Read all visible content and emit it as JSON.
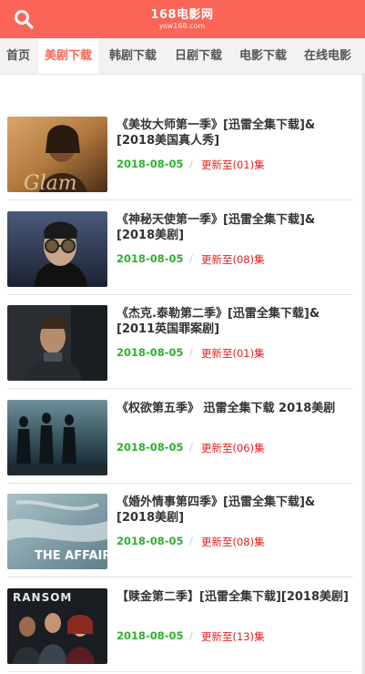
{
  "header": {
    "logo_text": "168电影网",
    "logo_sub": "ysw168.com"
  },
  "nav": {
    "items": [
      {
        "label": "首页",
        "active": false
      },
      {
        "label": "美剧下载",
        "active": true
      },
      {
        "label": "韩剧下载",
        "active": false
      },
      {
        "label": "日剧下载",
        "active": false
      },
      {
        "label": "电影下载",
        "active": false
      },
      {
        "label": "在线电影",
        "active": false
      }
    ]
  },
  "list": {
    "items": [
      {
        "title": "《美妆大师第一季》[迅雷全集下载]&[2018美国真人秀]",
        "date": "2018-08-05",
        "sep": "/",
        "status": "更新至(01)集",
        "thumb_text": "Glam"
      },
      {
        "title": "《神秘天使第一季》[迅雷全集下载]&[2018美剧]",
        "date": "2018-08-05",
        "sep": "/",
        "status": "更新至(08)集",
        "thumb_text": ""
      },
      {
        "title": "《杰克.泰勒第二季》[迅雷全集下载]&[2011英国罪案剧]",
        "date": "2018-08-05",
        "sep": "/",
        "status": "更新至(01)集",
        "thumb_text": ""
      },
      {
        "title": "《权欲第五季》 迅雷全集下载 2018美剧",
        "date": "2018-08-05",
        "sep": "/",
        "status": "更新至(06)集",
        "thumb_text": ""
      },
      {
        "title": "《婚外情事第四季》[迅雷全集下载]&[2018美剧]",
        "date": "2018-08-05",
        "sep": "/",
        "status": "更新至(08)集",
        "thumb_text": "THE AFFAIR"
      },
      {
        "title": "【赎金第二季】[迅雷全集下载][2018美剧]",
        "date": "2018-08-05",
        "sep": "/",
        "status": "更新至(13)集",
        "thumb_text": "RANSOM"
      }
    ]
  },
  "colors": {
    "brand": "#fa6557",
    "date_green": "#2db22d",
    "status_red": "#e42222"
  }
}
